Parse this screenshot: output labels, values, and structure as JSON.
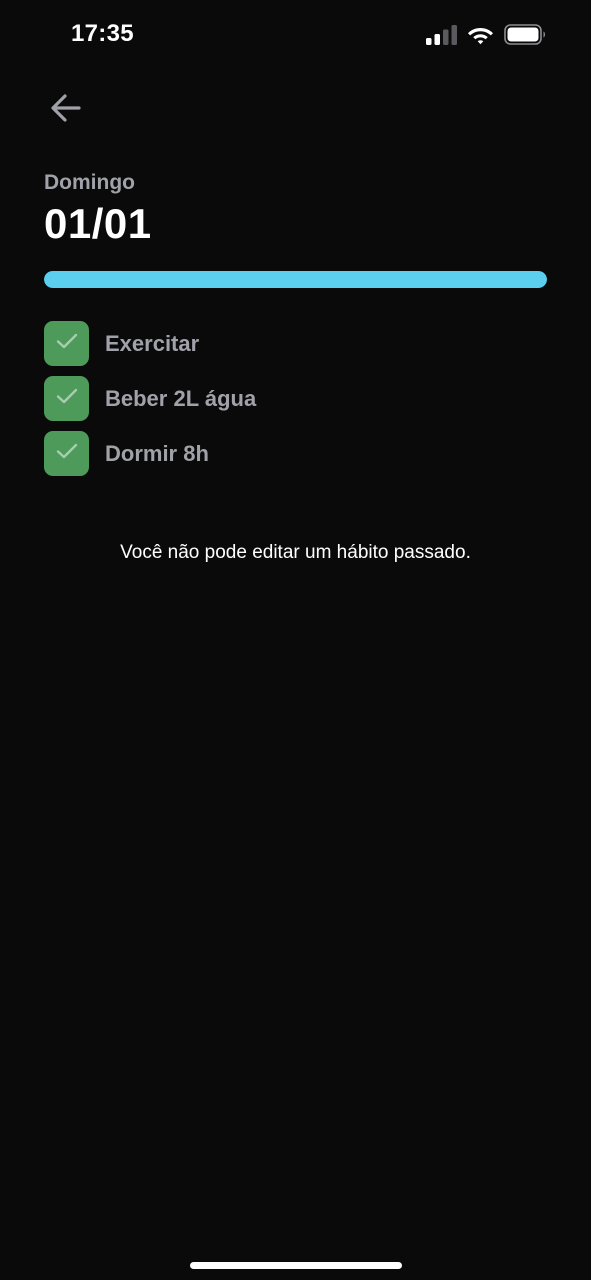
{
  "status_bar": {
    "time": "17:35",
    "icons": [
      "cellular-signal-icon",
      "wifi-icon",
      "battery-icon"
    ]
  },
  "nav": {
    "back_icon": "arrow-left-icon"
  },
  "header": {
    "weekday": "Domingo",
    "date": "01/01"
  },
  "progress": {
    "percent": 100,
    "color": "#5ccfef"
  },
  "habits": [
    {
      "label": "Exercitar",
      "checked": true
    },
    {
      "label": "Beber 2L água",
      "checked": true
    },
    {
      "label": "Dormir 8h",
      "checked": true
    }
  ],
  "notice": "Você não pode editar um hábito passado.",
  "colors": {
    "background": "#0a0a0a",
    "checkbox_checked": "#4e9a5b",
    "muted_text": "#a1a1aa"
  }
}
